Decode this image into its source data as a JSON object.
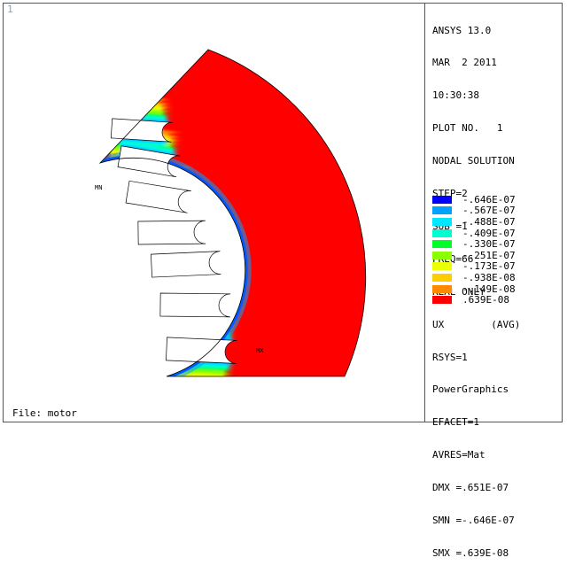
{
  "window": {
    "number": "1"
  },
  "file_label": "File: motor",
  "info_lines": [
    "ANSYS 13.0",
    "MAR  2 2011",
    "10:30:38",
    "PLOT NO.   1",
    "NODAL SOLUTION",
    "STEP=2",
    "SUB =1",
    "FREQ=66",
    "REAL ONLY",
    "UX        (AVG)",
    "RSYS=1",
    "PowerGraphics",
    "EFACET=1",
    "AVRES=Mat",
    "DMX =.651E-07",
    "SMN =-.646E-07",
    "SMX =.639E-08"
  ],
  "legend": [
    {
      "value": "-.646E-07",
      "color": "#0000ff"
    },
    {
      "value": "-.567E-07",
      "color": "#00a2ff"
    },
    {
      "value": "-.488E-07",
      "color": "#00e6ff"
    },
    {
      "value": "-.409E-07",
      "color": "#00ffd0"
    },
    {
      "value": "-.330E-07",
      "color": "#00ff2a"
    },
    {
      "value": "-.251E-07",
      "color": "#8bff00"
    },
    {
      "value": "-.173E-07",
      "color": "#eaff00"
    },
    {
      "value": "-.938E-08",
      "color": "#ffcc00"
    },
    {
      "value": "-.149E-08",
      "color": "#ff8a00"
    },
    {
      "value": ".639E-08",
      "color": "#ff0000"
    }
  ],
  "markers": {
    "min": "MN",
    "max": "MX"
  }
}
